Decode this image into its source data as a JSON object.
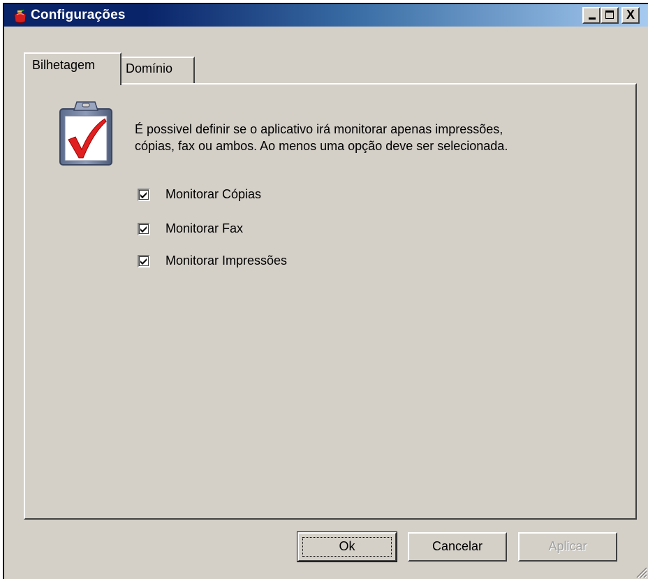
{
  "window": {
    "title": "Configurações",
    "controls": {
      "minimize": "_",
      "maximize": "□",
      "close": "X"
    }
  },
  "tabs": [
    {
      "label": "Bilhetagem",
      "active": true
    },
    {
      "label": "Domínio",
      "active": false
    }
  ],
  "panel": {
    "icon": "clipboard-check-icon",
    "description_lines": [
      "É possivel definir se o aplicativo irá monitorar apenas impressões,",
      "cópias, fax ou ambos. Ao menos uma opção deve ser selecionada."
    ],
    "checkboxes": [
      {
        "label": "Monitorar Cópias",
        "checked": true
      },
      {
        "label": "Monitorar Fax",
        "checked": true
      },
      {
        "label": "Monitorar Impressões",
        "checked": true
      }
    ]
  },
  "buttons": {
    "ok": "Ok",
    "cancel": "Cancelar",
    "apply": "Aplicar"
  },
  "colors": {
    "titlebar_start": "#0a246a",
    "titlebar_end": "#a6caf0",
    "face": "#d4d0c8",
    "check_red": "#e02020"
  }
}
